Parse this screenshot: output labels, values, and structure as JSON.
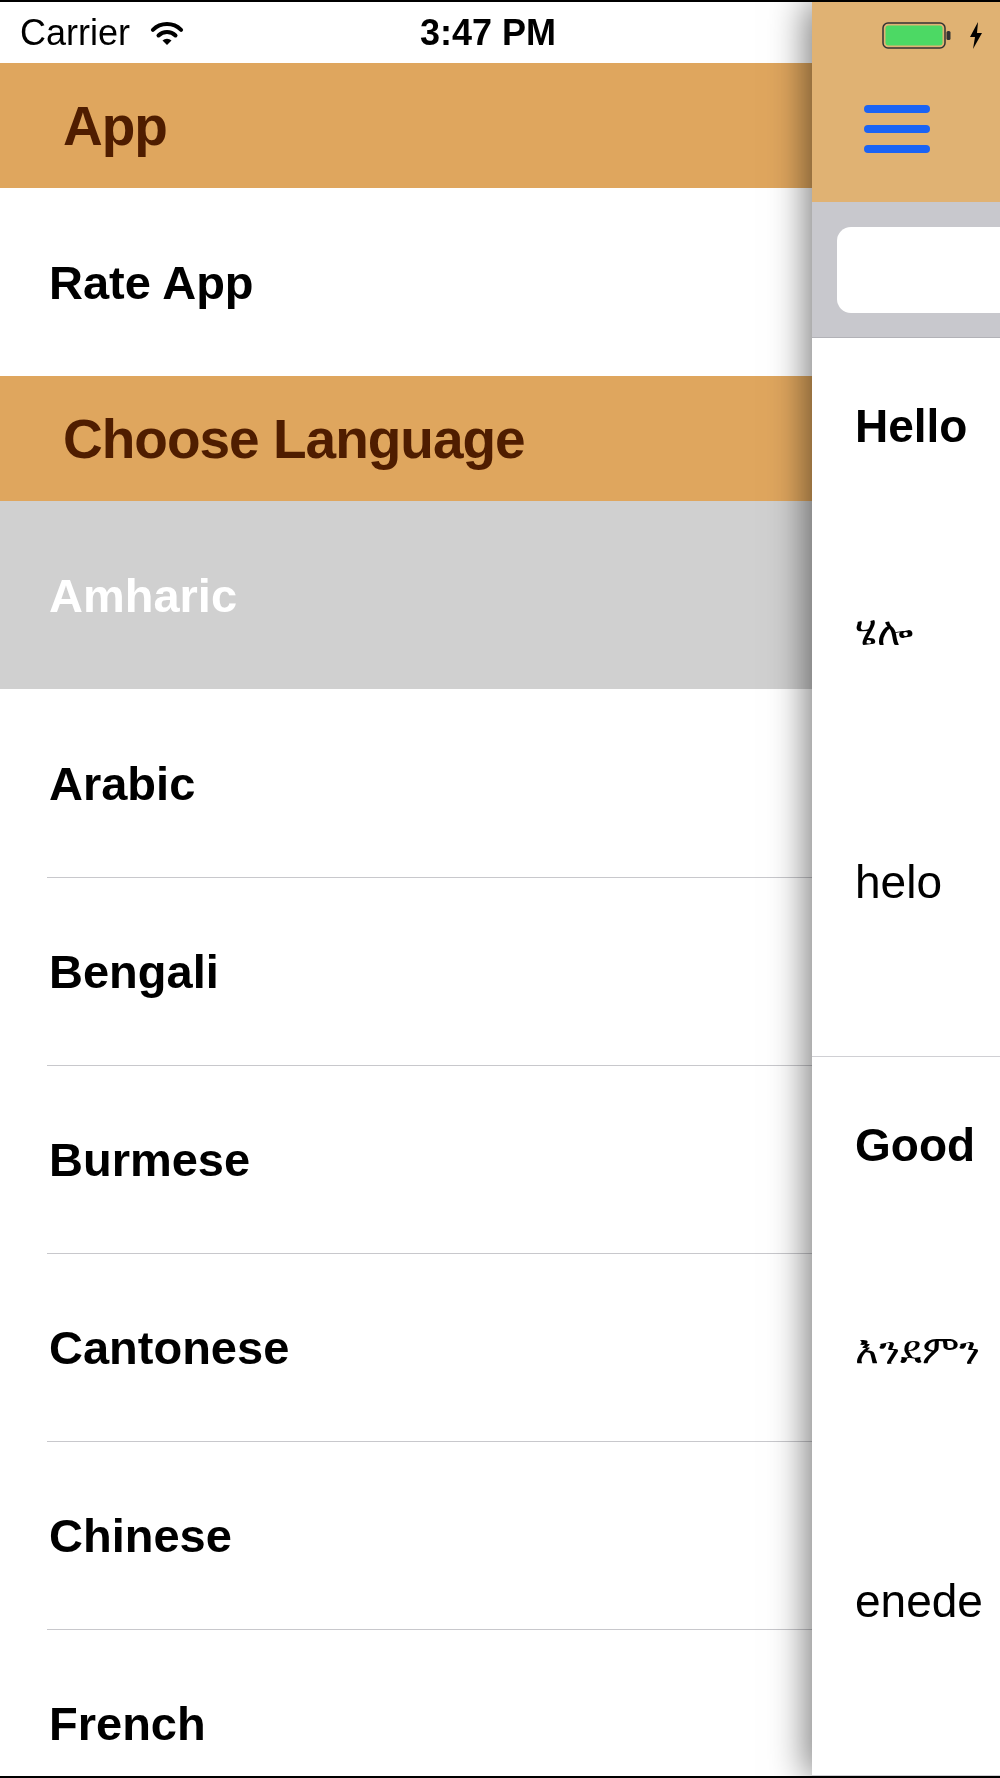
{
  "status_bar": {
    "carrier": "Carrier",
    "time": "3:47 PM"
  },
  "menu": {
    "sections": [
      {
        "title": "App",
        "items": [
          {
            "label": "Rate App",
            "selected": false
          }
        ]
      },
      {
        "title": "Choose Language",
        "items": [
          {
            "label": "Amharic",
            "selected": true
          },
          {
            "label": "Arabic",
            "selected": false
          },
          {
            "label": "Bengali",
            "selected": false
          },
          {
            "label": "Burmese",
            "selected": false
          },
          {
            "label": "Cantonese",
            "selected": false
          },
          {
            "label": "Chinese",
            "selected": false
          },
          {
            "label": "French",
            "selected": false
          }
        ]
      }
    ]
  },
  "phrases": [
    {
      "english": "Hello",
      "amharic": "ሄሎ",
      "transliteration": "helo"
    },
    {
      "english": "Good",
      "amharic": "እንደምን",
      "transliteration": "enede"
    }
  ]
}
